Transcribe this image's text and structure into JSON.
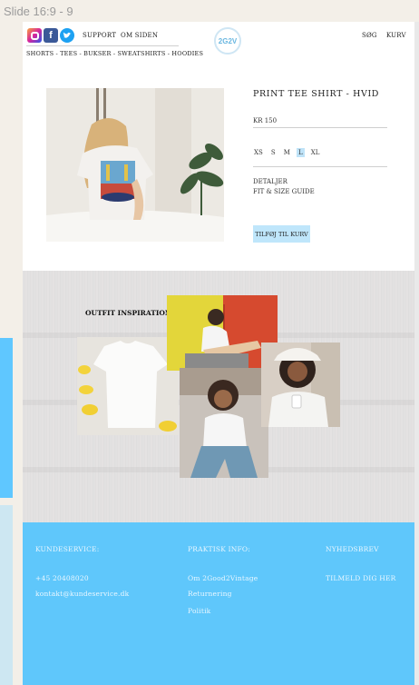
{
  "slide_label": "Slide 16:9 - 9",
  "header": {
    "social_icons": [
      "instagram-icon",
      "facebook-icon",
      "twitter-icon"
    ],
    "nav_left": [
      "SUPPORT",
      "OM SIDEN"
    ],
    "logo_text": "2G2V",
    "nav_right": [
      "SØG",
      "KURV"
    ],
    "categories": "SHORTS - TEES - BUKSER - SWEATSHIRTS - HOODIES"
  },
  "product": {
    "title": "PRINT TEE SHIRT - HVID",
    "price": "KR 150",
    "sizes": [
      "XS",
      "S",
      "M",
      "L",
      "XL"
    ],
    "selected_size": "L",
    "details_label": "DETALJER",
    "fit_label": "FIT & SIZE GUIDE",
    "add_to_cart_label": "TILFØJ TIL KURV"
  },
  "inspiration": {
    "title": "OUTFIT INSPIRATION"
  },
  "footer": {
    "col1": {
      "heading": "KUNDESERVICE:",
      "items": [
        "+45 20408020",
        "kontakt@kundeservice.dk"
      ]
    },
    "col2": {
      "heading": "PRAKTISK INFO:",
      "items": [
        "Om 2Good2Vintage",
        "Returnering",
        "Politik"
      ]
    },
    "col3": {
      "heading": "NYHEDSBREV",
      "items": [
        "TILMELD DIG HER"
      ]
    }
  },
  "colors": {
    "accent_blue": "#5fc7fb",
    "button_blue": "#bfe6fb",
    "selected_size": "#bfe3f8"
  }
}
